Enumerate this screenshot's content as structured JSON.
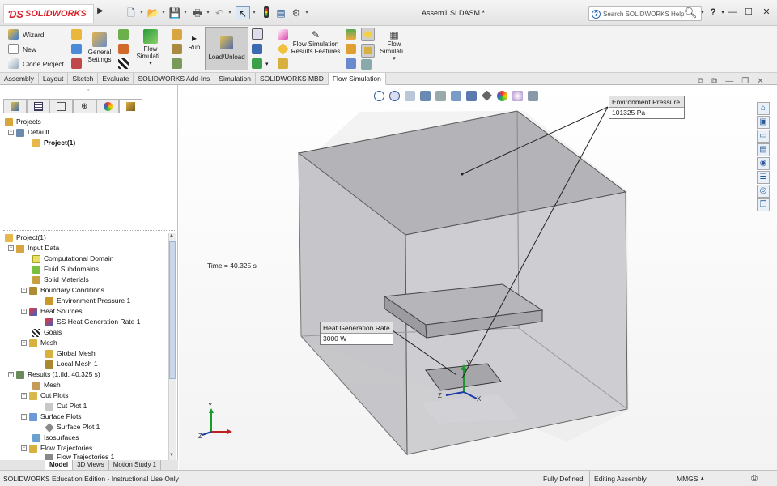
{
  "app": {
    "logo": "SOLIDWORKS",
    "document_title": "Assem1.SLDASM *",
    "search_placeholder": "Search SOLIDWORKS Help"
  },
  "ribbon": {
    "wizard": "Wizard",
    "new": "New",
    "clone_project": "Clone Project",
    "general_settings": "General Settings",
    "flow_simulation_1": "Flow Simulati...",
    "run": "Run",
    "load_unload": "Load/Unload",
    "results_features": "Flow Simulation Results Features",
    "flow_simulation_2": "Flow Simulati..."
  },
  "tabs": [
    "Assembly",
    "Layout",
    "Sketch",
    "Evaluate",
    "SOLIDWORKS Add-Ins",
    "Simulation",
    "SOLIDWORKS MBD",
    "Flow Simulation"
  ],
  "top_tree": {
    "projects": "Projects",
    "default": "Default",
    "project1": "Project(1)"
  },
  "tree": {
    "project1": "Project(1)",
    "input_data": "Input Data",
    "computational_domain": "Computational Domain",
    "fluid_subdomains": "Fluid Subdomains",
    "solid_materials": "Solid Materials",
    "boundary_conditions": "Boundary Conditions",
    "environment_pressure": "Environment Pressure 1",
    "heat_sources": "Heat Sources",
    "ss_heat_generation": "SS Heat Generation Rate 1",
    "goals": "Goals",
    "mesh": "Mesh",
    "global_mesh": "Global Mesh",
    "local_mesh": "Local Mesh 1",
    "results": "Results (1.fld, 40.325 s)",
    "results_mesh": "Mesh",
    "cut_plots": "Cut Plots",
    "cut_plot1": "Cut Plot 1",
    "surface_plots": "Surface Plots",
    "surface_plot1": "Surface Plot 1",
    "isosurfaces": "Isosurfaces",
    "flow_trajectories": "Flow Trajectories",
    "flow_trajectories1": "Flow Trajectories 1"
  },
  "bottom_tabs": [
    "Model",
    "3D Views",
    "Motion Study 1"
  ],
  "viewport": {
    "time_label": "Time = 40.325 s",
    "env_pressure_title": "Environment Pressure",
    "env_pressure_value": "101325 Pa",
    "heat_gen_title": "Heat Generation Rate",
    "heat_gen_value": "3000 W",
    "axis_x": "X",
    "axis_y": "Y",
    "axis_z": "Z"
  },
  "status": {
    "edition": "SOLIDWORKS Education Edition - Instructional Use Only",
    "state": "Fully Defined",
    "mode": "Editing Assembly",
    "units": "MMGS"
  }
}
